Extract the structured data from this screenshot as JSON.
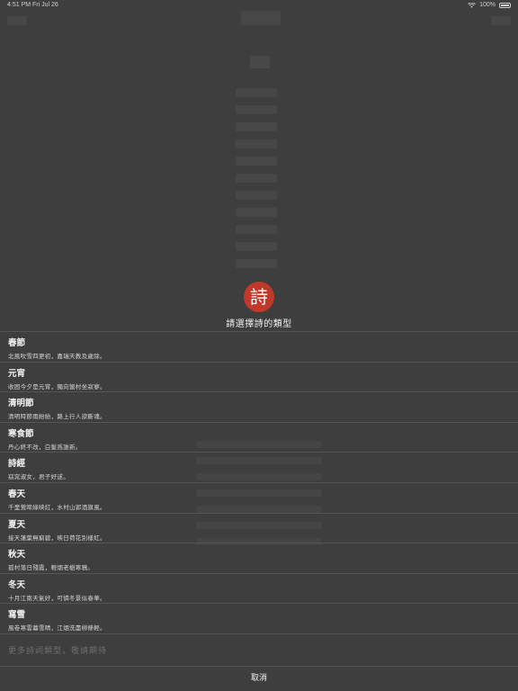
{
  "status_bar": {
    "time": "4:51 PM",
    "date": "Fri Jul 26",
    "battery": "100%"
  },
  "sheet": {
    "logo_char": "詩",
    "title": "請選擇詩的類型",
    "options": [
      {
        "name": "春節",
        "desc": "北風吹雪四更初，嘉瑞天教及歲除。"
      },
      {
        "name": "元宵",
        "desc": "收困今夕是元宵，獨向蠻村坐寂寥。"
      },
      {
        "name": "清明節",
        "desc": "清明時節雨紛紛，路上行人欲斷魂。"
      },
      {
        "name": "寒食節",
        "desc": "丹心終不改，白髮爲誰新。"
      },
      {
        "name": "詩經",
        "desc": "窈窕淑女，君子好逑。"
      },
      {
        "name": "春天",
        "desc": "千里鶯啼綠映紅，水村山郭酒旗風。"
      },
      {
        "name": "夏天",
        "desc": "接天蓮葉無窮碧，映日荷花別樣紅。"
      },
      {
        "name": "秋天",
        "desc": "孤村落日殘霞，輕烟老樹寒鴉。"
      },
      {
        "name": "冬天",
        "desc": "十月江南天氣好，可憐冬景似春華。"
      },
      {
        "name": "寫雪",
        "desc": "風卷寒雲暮雪晴，江烟洗盡柳條輕。"
      }
    ],
    "more_label": "更多詩詞類型，敬請期待",
    "cancel_label": "取消"
  }
}
